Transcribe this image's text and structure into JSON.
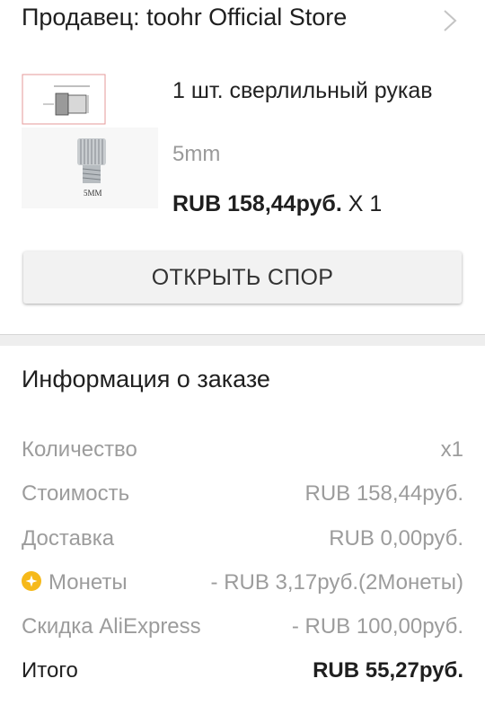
{
  "seller": {
    "label": "Продавец: toohr Official Store"
  },
  "product": {
    "title": "1 шт. сверлильный рукав",
    "variant": "5mm",
    "price": "RUB 158,44руб.",
    "quantity": "X 1",
    "image_label": "5MM"
  },
  "actions": {
    "open_dispute": "ОТКРЫТЬ СПОР"
  },
  "order_info": {
    "title": "Информация о заказе",
    "rows": [
      {
        "label": "Количество",
        "value": "x1"
      },
      {
        "label": "Стоимость",
        "value": "RUB 158,44руб."
      },
      {
        "label": "Доставка",
        "value": "RUB 0,00руб."
      },
      {
        "label": "Монеты",
        "value": "- RUB 3,17руб.(2Монеты)",
        "icon": "coin-icon"
      },
      {
        "label": "Скидка AliExpress",
        "value": "- RUB 100,00руб."
      }
    ],
    "total": {
      "label": "Итого",
      "value": "RUB 55,27руб."
    }
  },
  "colors": {
    "coin": "#f6b91a",
    "muted_text": "#9c9c9c",
    "button_bg": "#f2f2f2"
  }
}
